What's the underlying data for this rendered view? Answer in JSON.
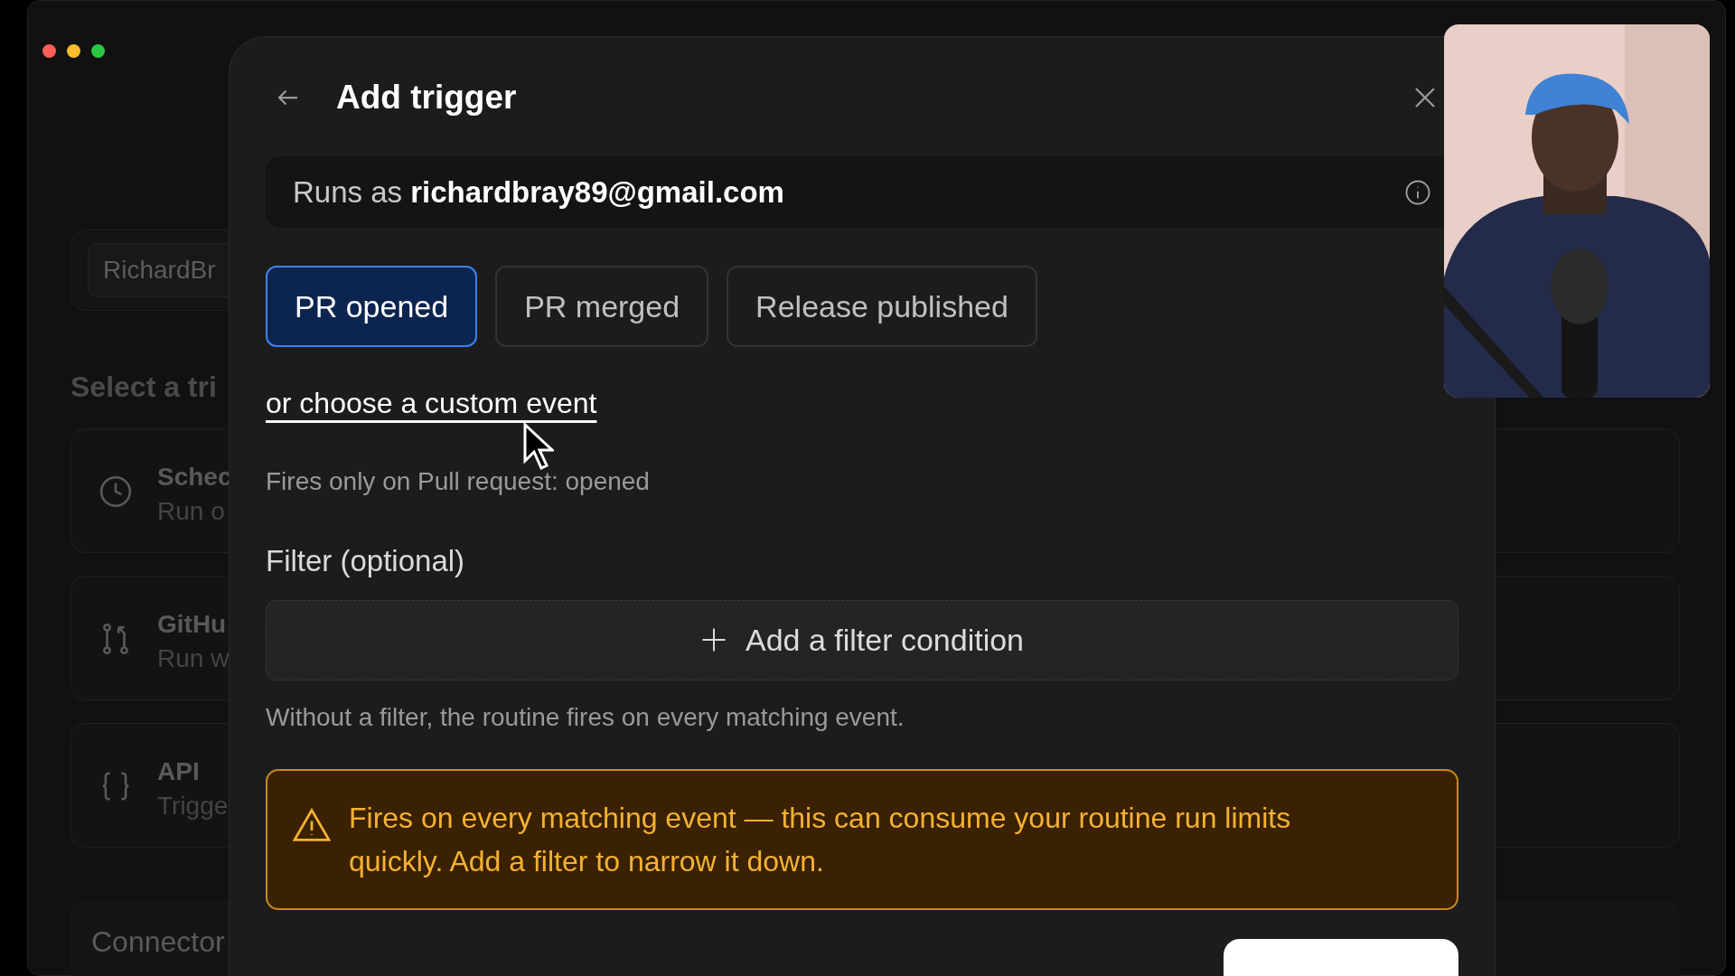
{
  "background": {
    "account_field": "RichardBr",
    "section_title": "Select a tri",
    "trigger_cards": [
      {
        "kind": "schedule",
        "title": "Schec",
        "subtitle": "Run o"
      },
      {
        "kind": "github",
        "title": "GitHu",
        "subtitle": "Run w"
      },
      {
        "kind": "api",
        "title": "API",
        "subtitle": "Trigge"
      }
    ],
    "connectors_title": "Connector"
  },
  "dialog": {
    "title": "Add trigger",
    "runs_as": {
      "label": "Runs as",
      "account": "richardbray89@gmail.com"
    },
    "events": [
      {
        "label": "PR opened",
        "selected": true
      },
      {
        "label": "PR merged",
        "selected": false
      },
      {
        "label": "Release published",
        "selected": false
      }
    ],
    "custom_event_link": "or choose a custom event",
    "event_note": "Fires only on Pull request: opened",
    "filter": {
      "heading": "Filter (optional)",
      "add_button": "Add a filter condition",
      "hint": "Without a filter, the routine fires on every matching event."
    },
    "warning": "Fires on every matching event — this can consume your routine run limits quickly. Add a filter to narrow it down."
  }
}
